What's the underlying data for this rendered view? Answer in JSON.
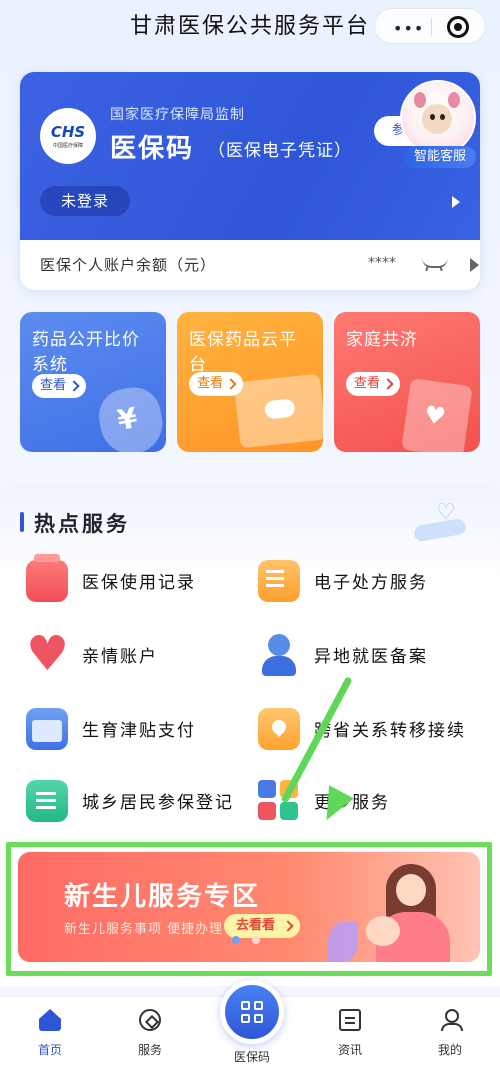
{
  "header": {
    "title": "甘肃医保公共服务平台",
    "menu_dots": "•••"
  },
  "card": {
    "supervise": "国家医疗保障局监制",
    "title": "医保码",
    "subtitle": "（医保电子凭证）",
    "param_label": "参",
    "login_label": "未登录",
    "balance_label": "医保个人账户余额（元）",
    "balance_masked": "****",
    "logo_text": "CHS",
    "logo_sub": "中国医疗保障"
  },
  "assistant": {
    "label": "智能客服"
  },
  "tiles": [
    {
      "title": "药品公开比价系统",
      "button": "查看"
    },
    {
      "title": "医保药品云平台",
      "button": "查看"
    },
    {
      "title": "家庭共济",
      "button": "查看"
    }
  ],
  "hot": {
    "title": "热点服务",
    "items": [
      "医保使用记录",
      "电子处方服务",
      "亲情账户",
      "异地就医备案",
      "生育津贴支付",
      "跨省关系转移接续",
      "城乡居民参保登记",
      "更多服务"
    ]
  },
  "banner": {
    "title": "新生儿服务专区",
    "subtitle": "新生儿服务事项 便捷办理",
    "button": "去看看"
  },
  "tabbar": {
    "items": [
      {
        "label": "首页",
        "icon": "home-icon",
        "active": true
      },
      {
        "label": "服务",
        "icon": "compass-icon",
        "active": false
      },
      {
        "label": "医保码",
        "icon": "qr-code-icon",
        "active": false
      },
      {
        "label": "资讯",
        "icon": "news-icon",
        "active": false
      },
      {
        "label": "我的",
        "icon": "user-icon",
        "active": false
      }
    ]
  },
  "colors": {
    "brand_blue": "#2f56d8",
    "highlight_green": "#6cdc5a"
  }
}
